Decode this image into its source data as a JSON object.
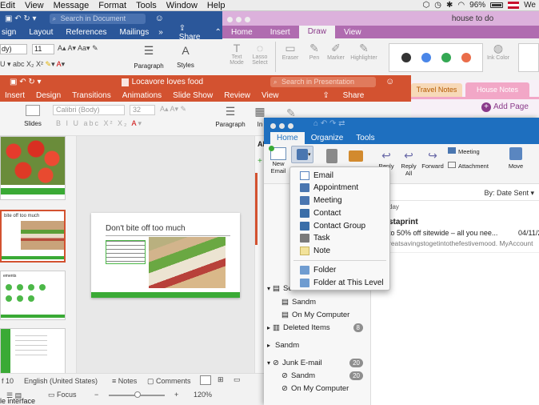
{
  "menubar": {
    "items": [
      "Edit",
      "View",
      "Message",
      "Format",
      "Tools",
      "Window",
      "Help"
    ],
    "battery": "96%"
  },
  "word": {
    "search_placeholder": "Search in Document",
    "tabs": [
      "sign",
      "Layout",
      "References",
      "Mailings"
    ],
    "share": "Share",
    "font": "dy)",
    "size": "11",
    "group_paragraph": "Paragraph",
    "group_styles": "Styles"
  },
  "onenote": {
    "title": "house to do",
    "tabs": [
      "Home",
      "Insert",
      "Draw",
      "View"
    ],
    "active_tab": "Draw",
    "tools": [
      "Text Mode",
      "Lasso Select",
      "Eraser",
      "Pen",
      "Marker",
      "Highlighter"
    ],
    "ink_color": "Ink Color",
    "section_tabs": [
      "Travel Notes",
      "House Notes"
    ],
    "add_page": "Add Page",
    "swatch_colors": [
      "#333333",
      "#4a86e8",
      "#34a853",
      "#ea6d4a"
    ]
  },
  "ppt": {
    "title": "Locavore loves food",
    "search_placeholder": "Search in Presentation",
    "tabs": [
      "Insert",
      "Design",
      "Transitions",
      "Animations",
      "Slide Show",
      "Review",
      "View"
    ],
    "share": "Share",
    "font": "Calibri (Body)",
    "size": "32",
    "group_slides": "Slides",
    "group_paragraph": "Paragraph",
    "group_in": "In",
    "slide_title": "Don't bite off too much",
    "slide_number": "f 10",
    "language": "English (United States)",
    "notes": "Notes",
    "comments": "Comments",
    "focus": "Focus",
    "zoom": "120%",
    "thumb_text": "bite off too much",
    "sidebar_label": "Al",
    "bottom_label": "le interface"
  },
  "outlook": {
    "tabs": [
      "Home",
      "Organize",
      "Tools"
    ],
    "active_tab": "Home",
    "new_email": "New Email",
    "buttons": [
      "Reply",
      "Reply All",
      "Forward"
    ],
    "meeting": "Meeting",
    "attachment": "Attachment",
    "move": "Move",
    "sort": "By: Date Sent",
    "section_header": "day",
    "message": {
      "sender": "staprint",
      "subject": "to 50% off sitewide – all you nee...",
      "date": "04/11/2",
      "preview": "reatsavingstogetintothefestivemood. MyAccount"
    },
    "folders": [
      {
        "label": "Sent Items",
        "indent": false,
        "count": ""
      },
      {
        "label": "Sandm",
        "indent": true,
        "count": ""
      },
      {
        "label": "On My Computer",
        "indent": true,
        "count": ""
      },
      {
        "label": "Deleted Items",
        "indent": false,
        "count": "8"
      },
      {
        "label": "Sandm",
        "indent": false,
        "count": ""
      },
      {
        "label": "Junk E-mail",
        "indent": false,
        "count": "20"
      },
      {
        "label": "Sandm",
        "indent": true,
        "count": "20"
      },
      {
        "label": "On My Computer",
        "indent": true,
        "count": ""
      }
    ]
  },
  "menu": {
    "items": [
      "Email",
      "Appointment",
      "Meeting",
      "Contact",
      "Contact Group",
      "Task",
      "Note"
    ],
    "folder_items": [
      "Folder",
      "Folder at This Level"
    ]
  }
}
